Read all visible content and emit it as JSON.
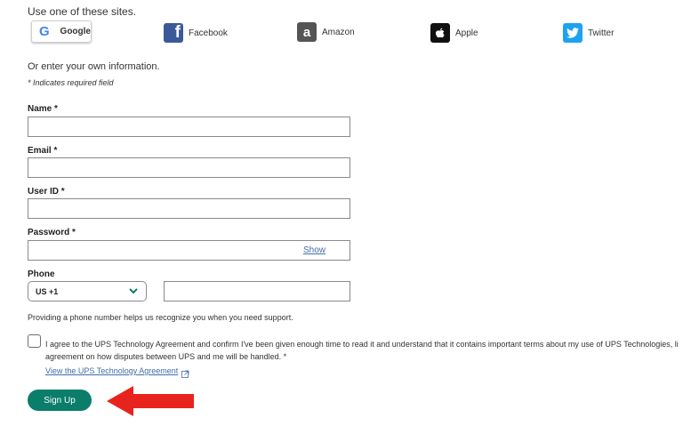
{
  "social_intro": "Use one of these sites.",
  "social": {
    "google": {
      "letter": "G",
      "label": "Google"
    },
    "facebook": {
      "letter": "f",
      "label": "Facebook"
    },
    "amazon": {
      "letter": "a",
      "label": "Amazon"
    },
    "apple": {
      "label": "Apple"
    },
    "twitter": {
      "label": "Twitter"
    }
  },
  "manual_intro": "Or enter your own information.",
  "required_note": "* Indicates required field",
  "fields": {
    "name": {
      "label": "Name *",
      "value": ""
    },
    "email": {
      "label": "Email *",
      "value": ""
    },
    "userid": {
      "label": "User ID *",
      "value": ""
    },
    "password": {
      "label": "Password *",
      "value": "",
      "show_label": "Show"
    },
    "phone": {
      "label": "Phone",
      "country": "US +1",
      "value": ""
    }
  },
  "phone_help": "Providing a phone number helps us recognize you when you need support.",
  "agreement": {
    "line1": "I agree to the UPS Technology Agreement and confirm I've been given enough time to read it and understand that it contains important terms about my use of UPS Technologies, li",
    "line2": "agreement on how disputes between UPS and me will be handled. *",
    "link": "View the UPS Technology Agreement"
  },
  "signup_label": "Sign Up",
  "colors": {
    "accent": "#0a7e6b",
    "link": "#426da9",
    "arrow": "#e8231e",
    "facebook": "#3b5998",
    "twitter": "#1da1f2"
  }
}
